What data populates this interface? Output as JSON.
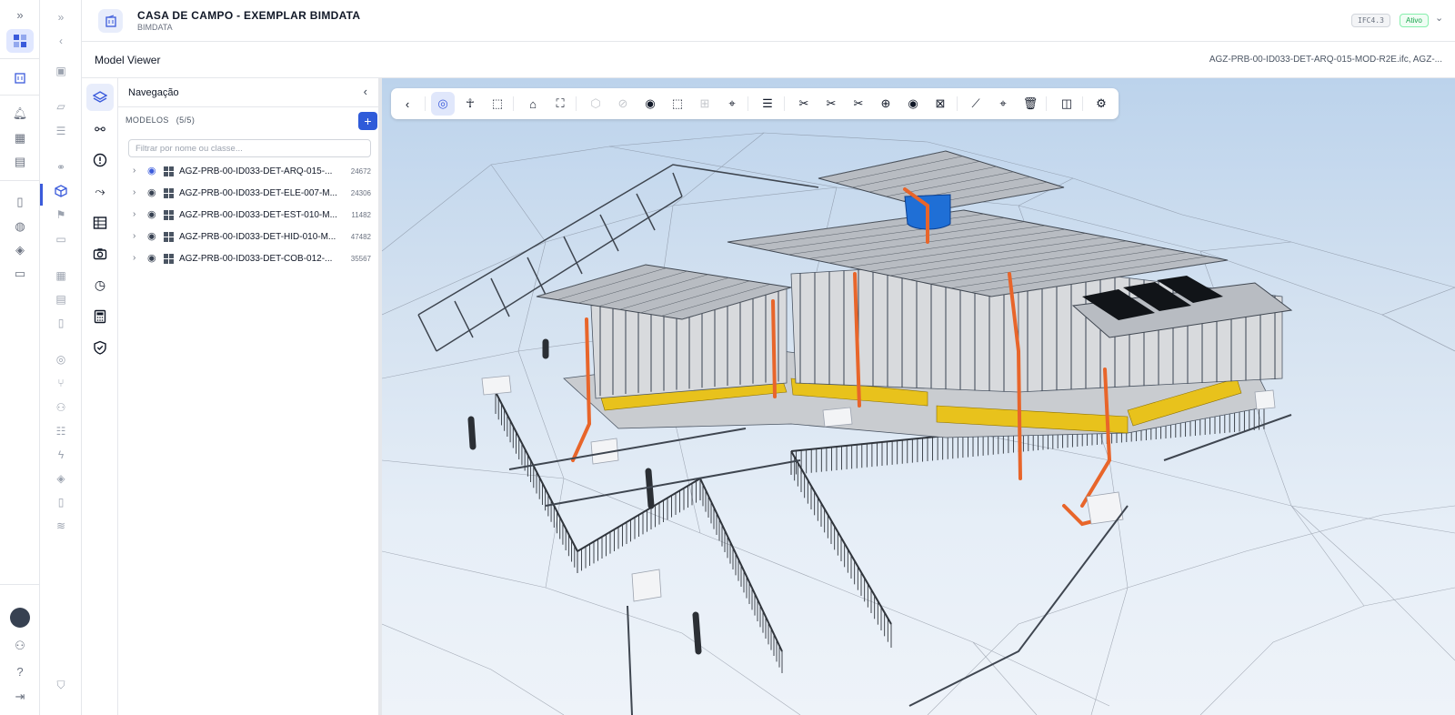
{
  "header": {
    "project_title": "CASA DE CAMPO - EXEMPLAR BIMDATA",
    "project_subtitle": "BIMDATA",
    "ifc_badge": "IFC4.3",
    "status_badge": "Ativo"
  },
  "titlebar": {
    "title": "Model Viewer",
    "files": "AGZ-PRB-00-ID033-DET-ARQ-015-MOD-R2E.ifc, AGZ-..."
  },
  "nav": {
    "title": "Navegação",
    "models_label": "MODELOS",
    "models_count": "(5/5)",
    "add_label": "+",
    "filter_placeholder": "Filtrar por nome ou classe...",
    "models": [
      {
        "name": "AGZ-PRB-00-ID033-DET-ARQ-015-...",
        "count": "24672"
      },
      {
        "name": "AGZ-PRB-00-ID033-DET-ELE-007-M...",
        "count": "24306"
      },
      {
        "name": "AGZ-PRB-00-ID033-DET-EST-010-M...",
        "count": "11482"
      },
      {
        "name": "AGZ-PRB-00-ID033-DET-HID-010-M...",
        "count": "47482"
      },
      {
        "name": "AGZ-PRB-00-ID033-DET-COB-012-...",
        "count": "35567"
      }
    ]
  },
  "colors": {
    "accent": "#3b5bdb",
    "pipe": "#e8652a",
    "tank": "#1f6fd6",
    "band": "#e8c21c"
  },
  "icons": {
    "rail1": [
      "expand-icon",
      "apps-icon",
      "building-icon",
      "bell-icon",
      "company-icon",
      "grid-icon",
      "book-icon",
      "database-icon",
      "tag-icon",
      "document-icon"
    ],
    "rail1_bottom": [
      "avatar",
      "user-settings-icon",
      "help-icon",
      "logout-icon"
    ],
    "rail2": [
      "chevrons-icon",
      "collapse-icon",
      "files-icon",
      "folder-icon",
      "checklist-icon",
      "link-icon",
      "cube-icon",
      "flag-icon",
      "chat-icon",
      "calendar-icon",
      "form-icon",
      "doc-icon",
      "target-icon",
      "branch-icon",
      "users-icon",
      "list-icon",
      "bolt-icon",
      "tags-icon",
      "report-icon",
      "layers-icon",
      "shield-icon"
    ],
    "tools": [
      "layers-icon",
      "binoculars-icon",
      "alert-icon",
      "route-icon",
      "table-icon",
      "camera-icon",
      "schedule-icon",
      "calculator-icon",
      "shield-check-icon"
    ],
    "viewer_toolbar": [
      "back-icon",
      "orbit-icon",
      "walk-icon",
      "select-icon",
      "home-icon",
      "fit-icon",
      "cube-ghost-icon",
      "hide-icon",
      "eye-icon",
      "box-select-icon",
      "grid-icon",
      "pin-icon",
      "list-icon",
      "section-x-icon",
      "section-y-icon",
      "section-z-icon",
      "crosshair-icon",
      "eye2-icon",
      "close-box-icon",
      "measure-icon",
      "locate-icon",
      "trash-icon",
      "compare-icon",
      "settings-icon"
    ]
  }
}
